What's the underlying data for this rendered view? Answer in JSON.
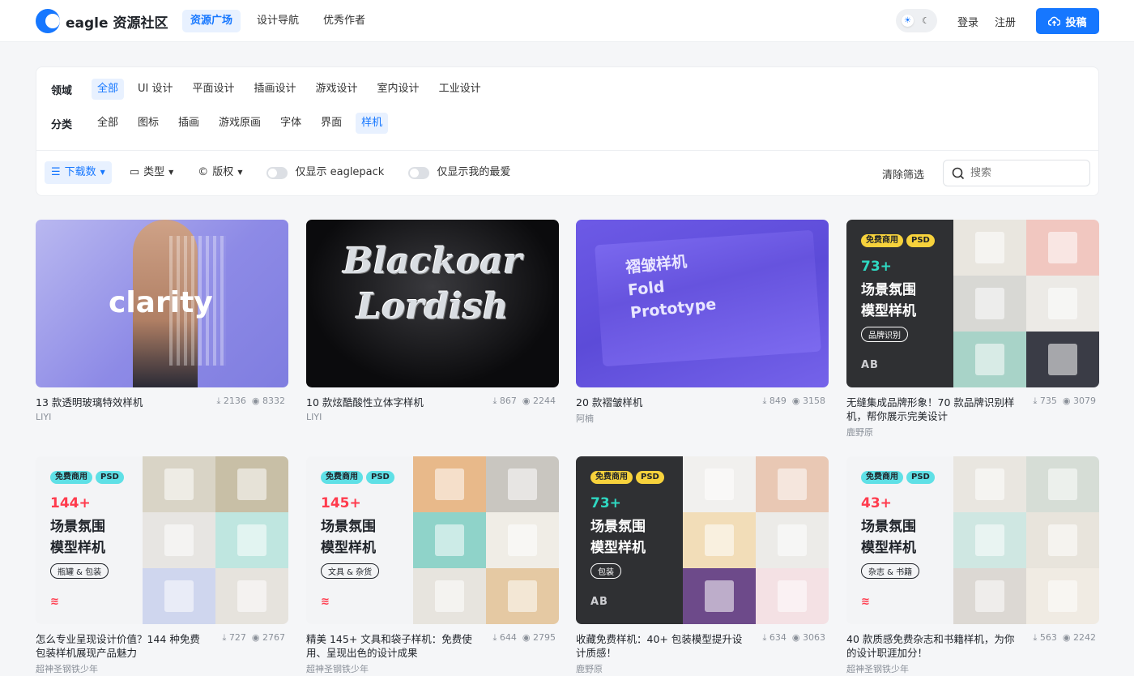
{
  "header": {
    "brand": "eagle 资源社区",
    "nav": [
      "资源广场",
      "设计导航",
      "优秀作者"
    ],
    "login": "登录",
    "register": "注册",
    "upload": "投稿"
  },
  "filters": {
    "domain_label": "领域",
    "domains": [
      "全部",
      "UI 设计",
      "平面设计",
      "插画设计",
      "游戏设计",
      "室内设计",
      "工业设计"
    ],
    "category_label": "分类",
    "categories": [
      "全部",
      "图标",
      "插画",
      "游戏原画",
      "字体",
      "界面",
      "样机"
    ],
    "sort": "下载数",
    "type": "类型",
    "license": "版权",
    "eaglepack": "仅显示 eaglepack",
    "favorites": "仅显示我的最爱",
    "clear": "清除筛选",
    "search_placeholder": "搜索"
  },
  "cards": [
    {
      "title": "13 款透明玻璃特效样机",
      "downloads": "2136",
      "views": "8332",
      "author": "LIYI",
      "art": "clarity"
    },
    {
      "title": "10 款炫酷酸性立体字样机",
      "downloads": "867",
      "views": "2244",
      "author": "LIYI",
      "art": "Blackoar Lordish"
    },
    {
      "title": "20 款褶皱样机",
      "downloads": "849",
      "views": "3158",
      "author": "阿楠",
      "art": "褶皱样机\nFold\nPrototype"
    },
    {
      "title": "无缝集成品牌形象！70 款品牌识别样机，帮你展示完美设计",
      "downloads": "735",
      "views": "3079",
      "author": "鹿野原",
      "promo": {
        "num": "73+",
        "line1": "场景氛围",
        "line2": "模型样机",
        "pill": "品牌识别",
        "logo": "AB"
      }
    },
    {
      "title": "怎么专业呈现设计价值？144 种免费包装样机展现产品魅力",
      "downloads": "727",
      "views": "2767",
      "author": "超神圣钢铁少年",
      "promo": {
        "num": "144+",
        "line1": "场景氛围",
        "line2": "模型样机",
        "pill": "瓶罐 & 包装",
        "logo": "≋"
      }
    },
    {
      "title": "精美 145+ 文具和袋子样机：免费使用、呈现出色的设计成果",
      "downloads": "644",
      "views": "2795",
      "author": "超神圣钢铁少年",
      "promo": {
        "num": "145+",
        "line1": "场景氛围",
        "line2": "模型样机",
        "pill": "文具 & 杂货",
        "logo": "≋"
      }
    },
    {
      "title": "收藏免费样机：40+ 包装模型提升设计质感！",
      "downloads": "634",
      "views": "3063",
      "author": "鹿野原",
      "promo": {
        "num": "73+",
        "line1": "场景氛围",
        "line2": "模型样机",
        "pill": "包装",
        "logo": "AB"
      }
    },
    {
      "title": "40 款质感免费杂志和书籍样机，为你的设计职涯加分！",
      "downloads": "563",
      "views": "2242",
      "author": "超神圣钢铁少年",
      "promo": {
        "num": "43+",
        "line1": "场景氛围",
        "line2": "模型样机",
        "pill": "杂志 & 书籍",
        "logo": "≋"
      }
    }
  ],
  "tags": {
    "free": "免费商用",
    "psd": "PSD"
  },
  "colors": {
    "accent": "#1677ff",
    "accent_bg": "#e8f1ff",
    "cyan_tag": "#5fe0e6",
    "yellow_tag": "#f7d23c"
  }
}
